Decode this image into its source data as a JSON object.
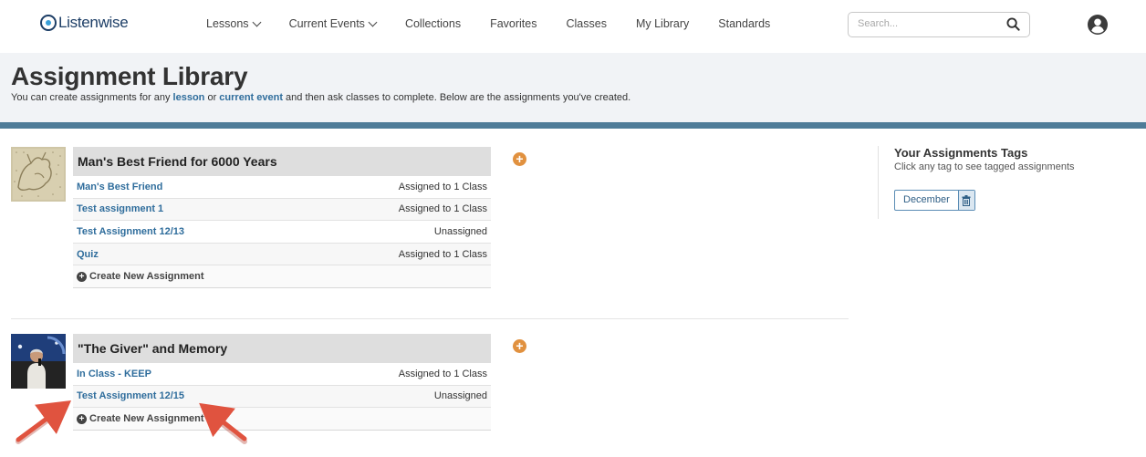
{
  "header": {
    "logo": "Listenwise",
    "nav": [
      {
        "label": "Lessons",
        "dropdown": true
      },
      {
        "label": "Current Events",
        "dropdown": true
      },
      {
        "label": "Collections",
        "dropdown": false
      },
      {
        "label": "Favorites",
        "dropdown": false
      },
      {
        "label": "Classes",
        "dropdown": false
      },
      {
        "label": "My Library",
        "dropdown": false
      },
      {
        "label": "Standards",
        "dropdown": false
      }
    ],
    "search_placeholder": "Search..."
  },
  "banner": {
    "title": "Assignment Library",
    "subtitle_prefix": "You can create assignments for any ",
    "link_lesson": "lesson",
    "subtitle_or": " or ",
    "link_current_event": "current event",
    "subtitle_suffix": " and then ask classes to complete. Below are the assignments you've created."
  },
  "lessons": [
    {
      "title": "Man's Best Friend for 6000 Years",
      "assignments": [
        {
          "name": "Man's Best Friend",
          "status": "Assigned to 1 Class"
        },
        {
          "name": "Test assignment 1",
          "status": "Assigned to 1 Class"
        },
        {
          "name": "Test Assignment 12/13",
          "status": "Unassigned"
        },
        {
          "name": "Quiz",
          "status": "Assigned to 1 Class"
        }
      ],
      "create_label": "Create New Assignment"
    },
    {
      "title": "\"The Giver\" and Memory",
      "assignments": [
        {
          "name": "In Class - KEEP",
          "status": "Assigned to 1 Class"
        },
        {
          "name": "Test Assignment 12/15",
          "status": "Unassigned"
        }
      ],
      "create_label": "Create New Assignment"
    }
  ],
  "tags_panel": {
    "title": "Your Assignments Tags",
    "subtitle": "Click any tag to see tagged assignments",
    "tags": [
      "December"
    ]
  },
  "colors": {
    "accent_link": "#2f6d9c",
    "banner_bar": "#4f7c98",
    "add_button": "#e1913f",
    "annotation_arrow": "#e0533f"
  }
}
